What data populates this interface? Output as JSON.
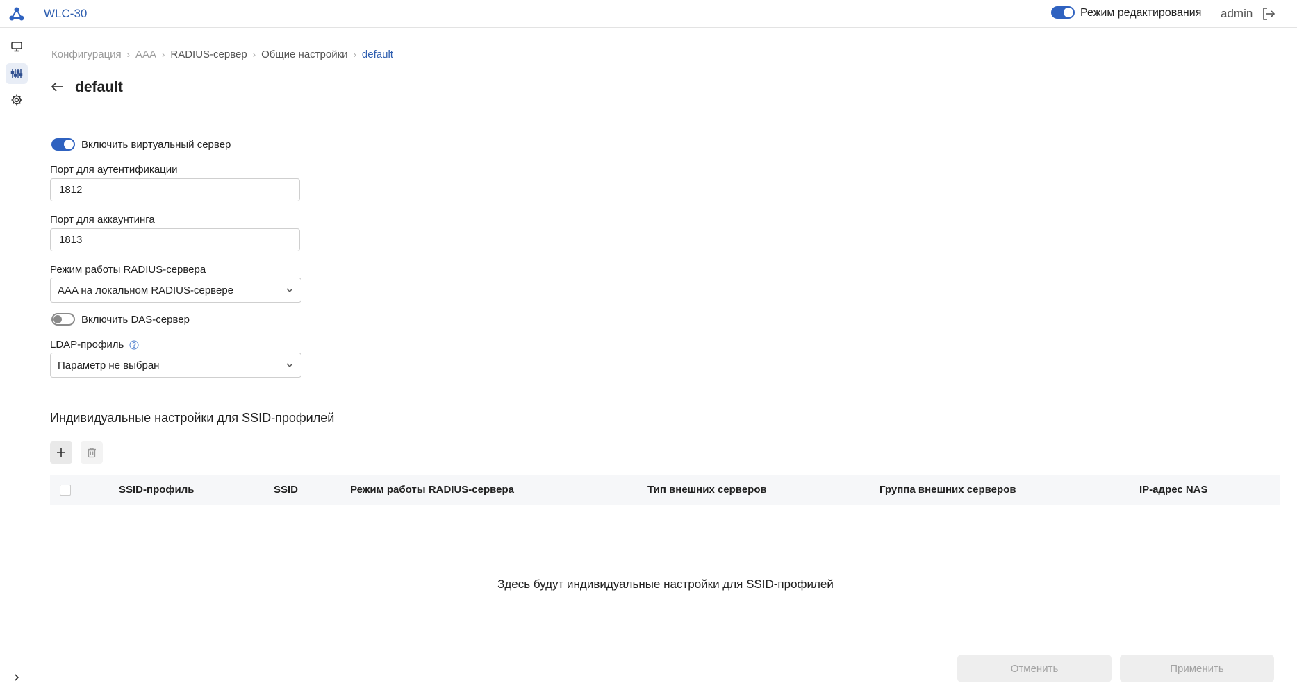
{
  "header": {
    "app_title": "WLC-30",
    "edit_mode_label": "Режим редактирования",
    "edit_mode_on": true,
    "user": "admin"
  },
  "breadcrumb": [
    "Конфигурация",
    "AAA",
    "RADIUS-сервер",
    "Общие настройки",
    "default"
  ],
  "page": {
    "title": "default"
  },
  "form": {
    "virtual_server_label": "Включить виртуальный сервер",
    "virtual_server_on": true,
    "auth_port_label": "Порт для аутентификации",
    "auth_port_value": "1812",
    "acct_port_label": "Порт для аккаунтинга",
    "acct_port_value": "1813",
    "mode_label": "Режим работы RADIUS-сервера",
    "mode_value": "AAA на локальном RADIUS-сервере",
    "das_label": "Включить DAS-сервер",
    "das_on": false,
    "ldap_label": "LDAP-профиль",
    "ldap_value": "Параметр не выбран"
  },
  "ssid_section": {
    "title": "Индивидуальные настройки для SSID-профилей",
    "columns": [
      "SSID-профиль",
      "SSID",
      "Режим работы RADIUS-сервера",
      "Тип внешних серверов",
      "Группа внешних серверов",
      "IP-адрес NAS"
    ],
    "empty_text": "Здесь будут индивидуальные настройки для SSID-профилей"
  },
  "footer": {
    "cancel_label": "Отменить",
    "apply_label": "Применить"
  },
  "colors": {
    "accent": "#2f62c0",
    "link": "#2f5fb0"
  },
  "icons": {
    "logo": "network-logo-icon",
    "logout": "logout-icon",
    "monitor": "monitor-icon",
    "config": "sliders-icon",
    "settings": "gear-icon",
    "back": "arrow-left-icon",
    "help": "help-icon",
    "add": "plus-icon",
    "delete": "trash-icon",
    "expand": "chevron-right-icon",
    "dropdown": "chevron-down-icon"
  }
}
